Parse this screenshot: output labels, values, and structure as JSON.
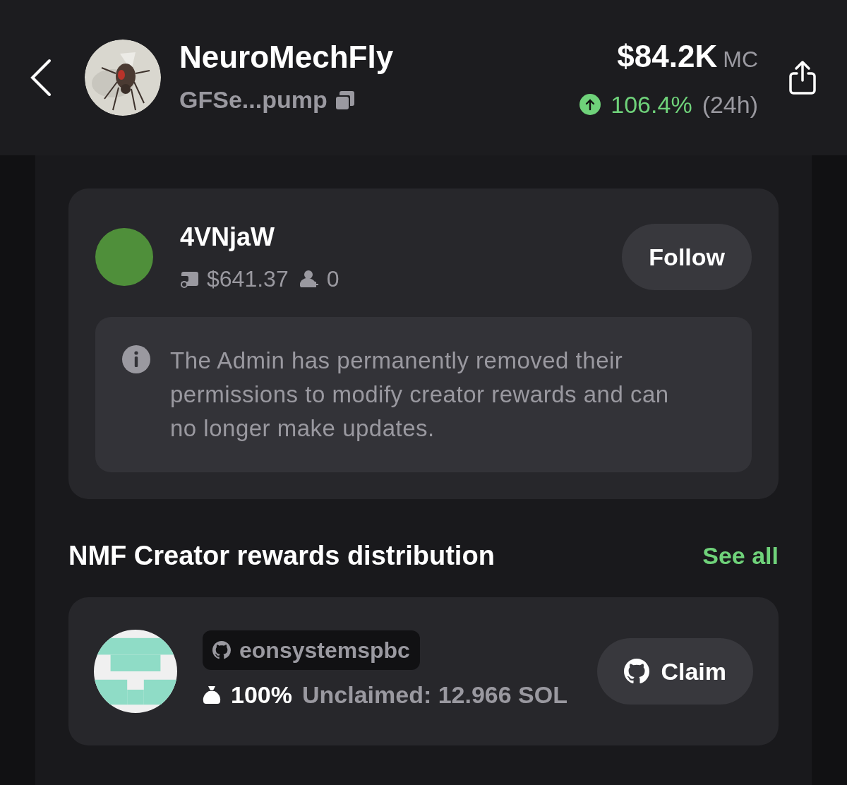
{
  "header": {
    "name": "NeuroMechFly",
    "address": "GFSe...pump",
    "market_cap": "$84.2K",
    "market_cap_label": "MC",
    "change": "106.4%",
    "change_period": "(24h)",
    "rising": true
  },
  "creator_section": {
    "creator": {
      "name": "4VNjaW",
      "balance": "$641.37",
      "followers": "0"
    },
    "follow_button": "Follow",
    "notice": "The Admin has permanently removed their permissions to modify creator rewards and can no longer make updates."
  },
  "rewards_section": {
    "title": "NMF Creator rewards distribution",
    "see_all": "See all",
    "recipients": [
      {
        "handle": "eonsystemspbc",
        "share": "100%",
        "unclaimed": "Unclaimed: 12.966 SOL",
        "claim_button": "Claim"
      }
    ]
  }
}
